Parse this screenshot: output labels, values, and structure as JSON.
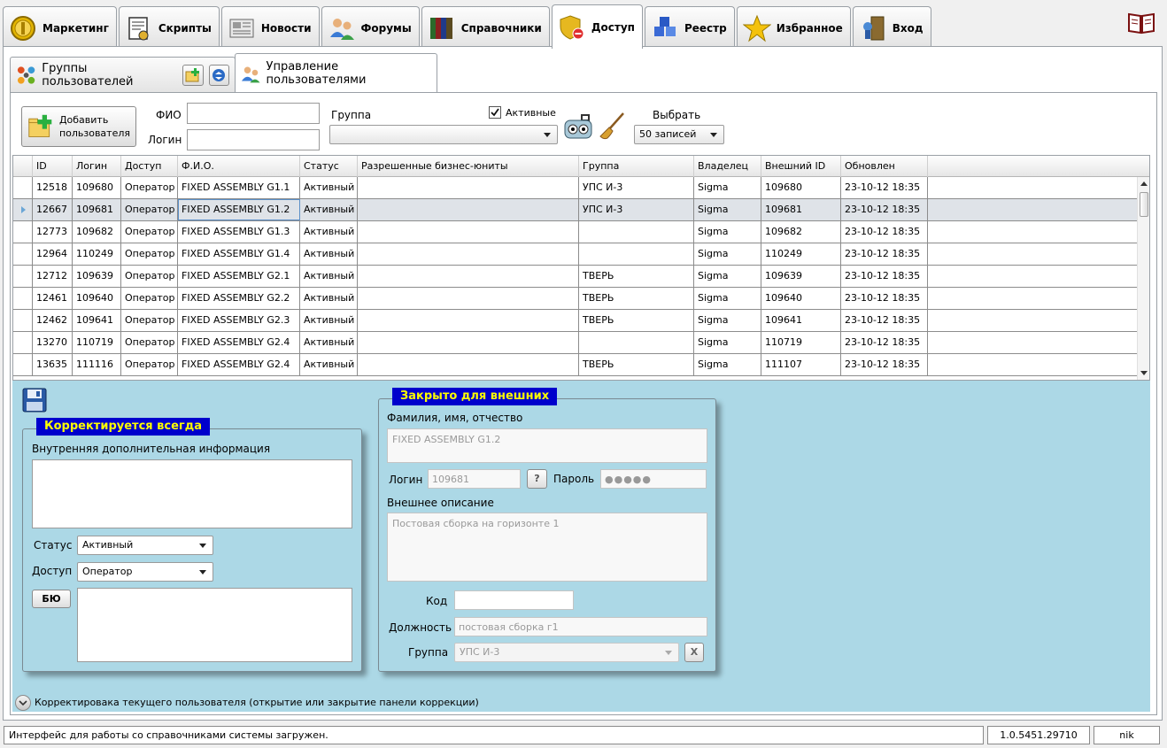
{
  "main_tabs": [
    {
      "label": "Маркетинг",
      "icon": "coin-icon"
    },
    {
      "label": "Скрипты",
      "icon": "script-icon"
    },
    {
      "label": "Новости",
      "icon": "news-icon"
    },
    {
      "label": "Форумы",
      "icon": "forum-users-icon"
    },
    {
      "label": "Справочники",
      "icon": "books-icon"
    },
    {
      "label": "Доступ",
      "icon": "shield-icon",
      "active": true
    },
    {
      "label": "Реестр",
      "icon": "cubes-icon"
    },
    {
      "label": "Избранное",
      "icon": "star-icon"
    },
    {
      "label": "Вход",
      "icon": "door-icon"
    }
  ],
  "sub_tabs": {
    "groups_label": "Группы пользователей",
    "users_label": "Управление пользователями"
  },
  "filter": {
    "add_user_label_1": "Добавить",
    "add_user_label_2": "пользователя",
    "fio_label": "ФИО",
    "fio_value": "",
    "login_label": "Логин",
    "login_value": "",
    "group_label": "Группа",
    "group_value": "",
    "active_label": "Активные",
    "active_checked": true,
    "select_label": "Выбрать",
    "select_value": "50 записей"
  },
  "grid": {
    "columns": [
      "ID",
      "Логин",
      "Доступ",
      "Ф.И.О.",
      "Статус",
      "Разрешенные бизнес-юниты",
      "Группа",
      "Владелец",
      "Внешний ID",
      "Обновлен"
    ],
    "rows": [
      [
        "12518",
        "109680",
        "Оператор",
        "FIXED ASSEMBLY G1.1",
        "Активный",
        "",
        "УПС И-3",
        "Sigma",
        "109680",
        "23-10-12 18:35"
      ],
      [
        "12667",
        "109681",
        "Оператор",
        "FIXED ASSEMBLY G1.2",
        "Активный",
        "",
        "УПС И-3",
        "Sigma",
        "109681",
        "23-10-12 18:35"
      ],
      [
        "12773",
        "109682",
        "Оператор",
        "FIXED ASSEMBLY G1.3",
        "Активный",
        "",
        "",
        "Sigma",
        "109682",
        "23-10-12 18:35"
      ],
      [
        "12964",
        "110249",
        "Оператор",
        "FIXED ASSEMBLY G1.4",
        "Активный",
        "",
        "",
        "Sigma",
        "110249",
        "23-10-12 18:35"
      ],
      [
        "12712",
        "109639",
        "Оператор",
        "FIXED ASSEMBLY G2.1",
        "Активный",
        "",
        "ТВЕРЬ",
        "Sigma",
        "109639",
        "23-10-12 18:35"
      ],
      [
        "12461",
        "109640",
        "Оператор",
        "FIXED ASSEMBLY G2.2",
        "Активный",
        "",
        "ТВЕРЬ",
        "Sigma",
        "109640",
        "23-10-12 18:35"
      ],
      [
        "12462",
        "109641",
        "Оператор",
        "FIXED ASSEMBLY G2.3",
        "Активный",
        "",
        "ТВЕРЬ",
        "Sigma",
        "109641",
        "23-10-12 18:35"
      ],
      [
        "13270",
        "110719",
        "Оператор",
        "FIXED ASSEMBLY G2.4",
        "Активный",
        "",
        "",
        "Sigma",
        "110719",
        "23-10-12 18:35"
      ],
      [
        "13635",
        "111116",
        "Оператор",
        "FIXED ASSEMBLY G2.4",
        "Активный",
        "",
        "ТВЕРЬ",
        "Sigma",
        "111107",
        "23-10-12 18:35"
      ]
    ]
  },
  "always_box": {
    "title": "Корректируется всегда",
    "internal_info_label": "Внутренняя дополнительная информация",
    "internal_info_value": "",
    "status_label": "Статус",
    "status_value": "Активный",
    "access_label": "Доступ",
    "access_value": "Оператор",
    "bu_button": "БЮ"
  },
  "closed_box": {
    "title": "Закрыто для внешних",
    "fio_label": "Фамилия, имя, отчество",
    "fio_value": "FIXED ASSEMBLY G1.2",
    "login_label": "Логин",
    "login_value": "109681",
    "help_button": "?",
    "password_label": "Пароль",
    "password_value": "●●●●●",
    "ext_desc_label": "Внешнее описание",
    "ext_desc_value": "Постовая сборка на горизонте 1",
    "code_label": "Код",
    "code_value": "",
    "position_label": "Должность",
    "position_value": "постовая сборка г1",
    "group_label": "Группа",
    "group_value": "УПС И-3",
    "clear_button": "X"
  },
  "expander_label": "Корректировака текущего пользователя (открытие или закрытие панели коррекции)",
  "status_bar": {
    "message": "Интерфейс для работы со справочниками системы загружен.",
    "version": "1.0.5451.29710",
    "user": "nik"
  },
  "colors": {
    "detail_bg": "#acd8e6",
    "group_title_bg": "#0000cc",
    "group_title_fg": "#ffff00",
    "selected_row": "#dfe3e8"
  }
}
